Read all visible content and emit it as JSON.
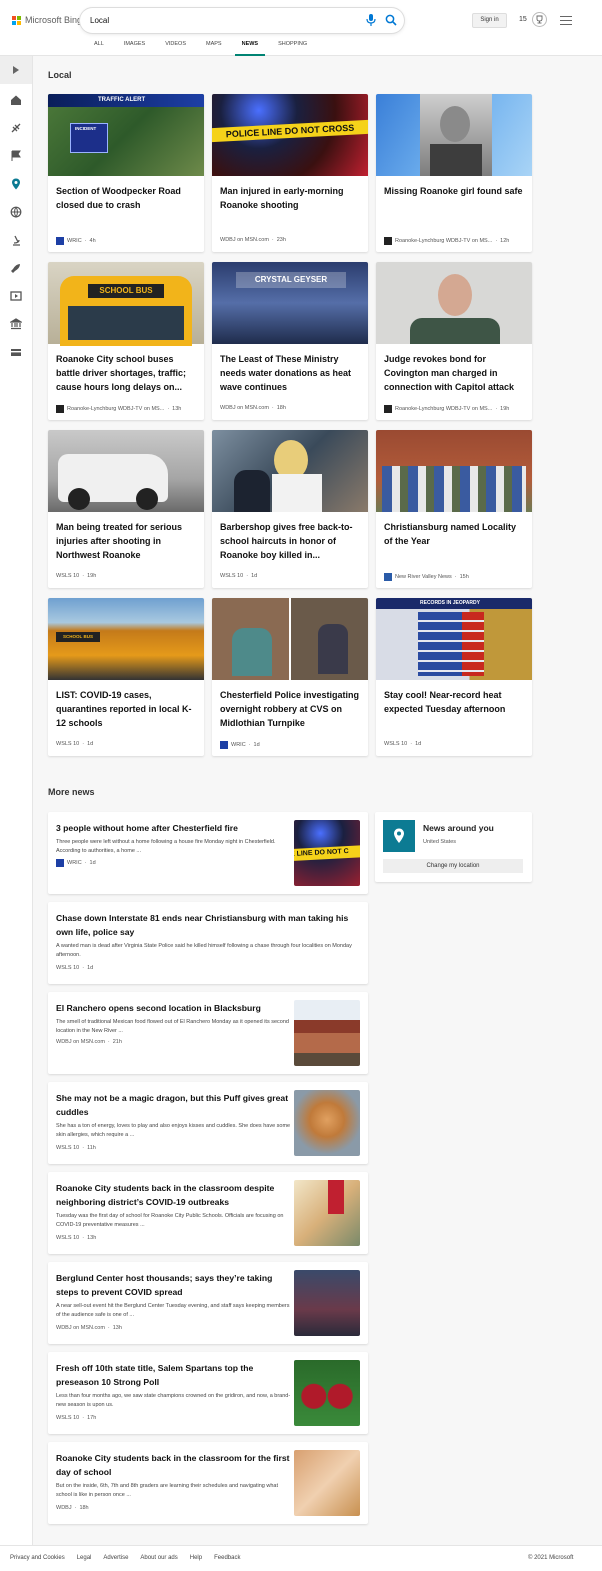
{
  "header": {
    "brand": "Microsoft Bing",
    "query": "Local",
    "signin": "Sign in",
    "points": "15"
  },
  "tabs": [
    "ALL",
    "IMAGES",
    "VIDEOS",
    "MAPS",
    "NEWS",
    "SHOPPING"
  ],
  "active_tab": "NEWS",
  "section_title": "Local",
  "cards": [
    {
      "title": "Section of Woodpecker Road closed due to crash",
      "source": "WRIC",
      "time": "4h",
      "thumb_text": "TRAFFIC ALERT",
      "thumb_badge": "INCIDENT"
    },
    {
      "title": "Man injured in early-morning Roanoke shooting",
      "source": "WDBJ on MSN.com",
      "time": "23h",
      "thumb_text": "POLICE LINE DO NOT CROSS"
    },
    {
      "title": "Missing Roanoke girl found safe",
      "source": "Roanoke-Lynchburg WDBJ-TV on MS...",
      "time": "12h"
    },
    {
      "title": "Roanoke City school buses battle driver shortages, traffic; cause hours long delays on...",
      "source": "Roanoke-Lynchburg WDBJ-TV on MS...",
      "time": "13h",
      "thumb_text": "SCHOOL BUS"
    },
    {
      "title": "The Least of These Ministry needs water donations as heat wave continues",
      "source": "WDBJ on MSN.com",
      "time": "18h",
      "thumb_text": "CRYSTAL GEYSER"
    },
    {
      "title": "Judge revokes bond for Covington man charged in connection with Capitol attack",
      "source": "Roanoke-Lynchburg WDBJ-TV on MS...",
      "time": "19h"
    },
    {
      "title": "Man being treated for serious injuries after shooting in Northwest Roanoke",
      "source": "WSLS 10",
      "time": "19h"
    },
    {
      "title": "Barbershop gives free back-to-school haircuts in honor of Roanoke boy killed in...",
      "source": "WSLS 10",
      "time": "1d"
    },
    {
      "title": "Christiansburg named Locality of the Year",
      "source": "New River Valley News",
      "time": "15h"
    },
    {
      "title": "LIST: COVID-19 cases, quarantines reported in local K-12 schools",
      "source": "WSLS 10",
      "time": "1d",
      "thumb_text": "SCHOOL BUS"
    },
    {
      "title": "Chesterfield Police investigating overnight robbery at CVS on Midlothian Turnpike",
      "source": "WRIC",
      "time": "1d"
    },
    {
      "title": "Stay cool! Near-record heat expected Tuesday afternoon",
      "source": "WSLS 10",
      "time": "1d",
      "thumb_text": "RECORDS IN JEOPARDY"
    }
  ],
  "more_title": "More news",
  "more": [
    {
      "title": "3 people without home after Chesterfield fire",
      "desc": "Three people were left without a home following a house fire Monday night in Chesterfield. According to authorities, a home ...",
      "source": "WRIC",
      "time": "1d",
      "thumb_text": "E LINE DO NOT C"
    },
    {
      "title": "Chase down Interstate 81 ends near Christiansburg with man taking his own life, police say",
      "desc": "A wanted man is dead after Virginia State Police said he killed himself following a chase through four localities on Monday afternoon.",
      "source": "WSLS 10",
      "time": "1d"
    },
    {
      "title": "El Ranchero opens second location in Blacksburg",
      "desc": "The smell of traditional Mexican food flowed out of El Ranchero Monday as it opened its second location in the New River ...",
      "source": "WDBJ on MSN.com",
      "time": "21h"
    },
    {
      "title": "She may not be a magic dragon, but this Puff gives great cuddles",
      "desc": "She has a ton of energy, loves to play and also enjoys kisses and cuddles. She does have some skin allergies, which require a ...",
      "source": "WSLS 10",
      "time": "11h"
    },
    {
      "title": "Roanoke City students back in the classroom despite neighboring district’s COVID-19 outbreaks",
      "desc": "Tuesday was the first day of school for Roanoke City Public Schools. Officials are focusing on COVID-19 preventative measures ...",
      "source": "WSLS 10",
      "time": "13h"
    },
    {
      "title": "Berglund Center host thousands; says they’re taking steps to prevent COVID spread",
      "desc": "A near sell-out event hit the Berglund Center Tuesday evening, and staff says keeping members of the audience safe is one of ...",
      "source": "WDBJ on MSN.com",
      "time": "13h"
    },
    {
      "title": "Fresh off 10th state title, Salem Spartans top the preseason 10 Strong Poll",
      "desc": "Less than four months ago, we saw state champions crowned on the gridiron, and now, a brand-new season is upon us.",
      "source": "WSLS 10",
      "time": "17h"
    },
    {
      "title": "Roanoke City students back in the classroom for the first day of school",
      "desc": "But on the inside, 6th, 7th and 8th graders are learning their schedules and navigating what school is like in person once ...",
      "source": "WDBJ",
      "time": "18h"
    }
  ],
  "around": {
    "title": "News around you",
    "location": "United States",
    "button": "Change my location"
  },
  "footer": {
    "links": [
      "Privacy and Cookies",
      "Legal",
      "Advertise",
      "About our ads",
      "Help",
      "Feedback"
    ],
    "copyright": "© 2021 Microsoft"
  },
  "colors": {
    "accent": "#008373",
    "location_tile": "#0c7b93",
    "mic": "#0078d4"
  }
}
